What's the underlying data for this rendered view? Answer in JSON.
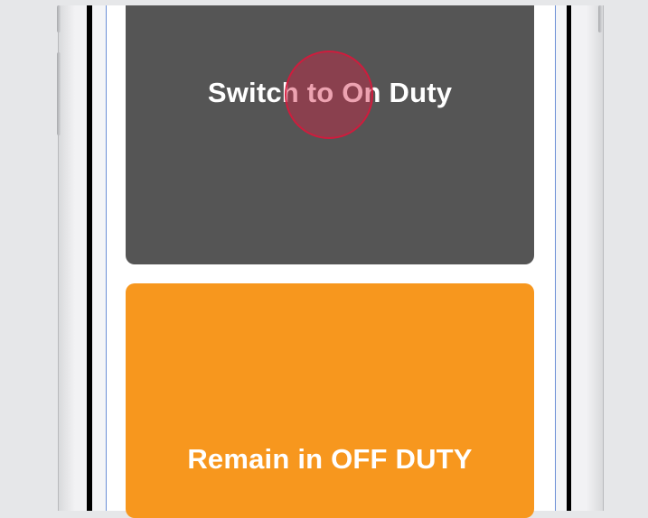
{
  "buttons": {
    "switch_on_duty": "Switch to On Duty",
    "remain_off_duty": "Remain in OFF DUTY"
  },
  "colors": {
    "on_duty_button": "#555555",
    "off_duty_button": "#F7971E",
    "tap_indicator": "#D6183C"
  },
  "icons": {
    "tap_indicator": "tap-indicator-icon"
  }
}
